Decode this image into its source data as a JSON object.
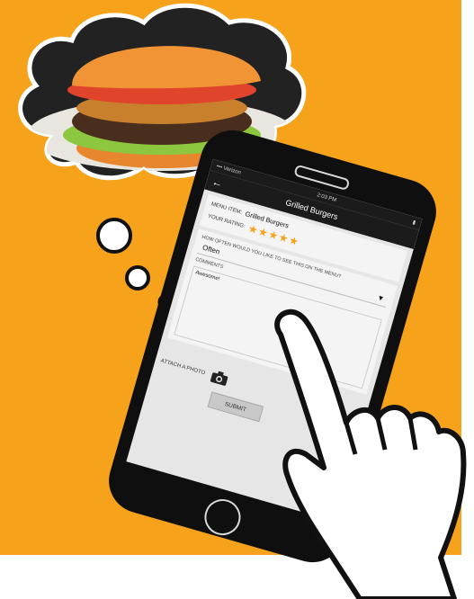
{
  "colors": {
    "background": "#f7a21b",
    "accent": "#f7a21b",
    "dark": "#1b1b1b"
  },
  "status_bar": {
    "carrier": "••• Verizon",
    "time": "2:03 PM"
  },
  "header": {
    "back_icon": "arrow-left-icon",
    "title": "Grilled Burgers"
  },
  "form": {
    "menu_item_label": "MENU ITEM:",
    "menu_item_value": "Grilled Burgers",
    "rating_label": "YOUR RATING:",
    "rating_stars": "★★★★★",
    "rating_value": 5,
    "frequency_question": "HOW OFTEN WOULD YOU LIKE TO SEE THIS ON THE MENU?",
    "frequency_value": "Often",
    "comments_label": "COMMENTS",
    "comments_value": "Awesome!",
    "attach_label": "ATTACH A PHOTO",
    "submit_label": "SUBMIT"
  }
}
